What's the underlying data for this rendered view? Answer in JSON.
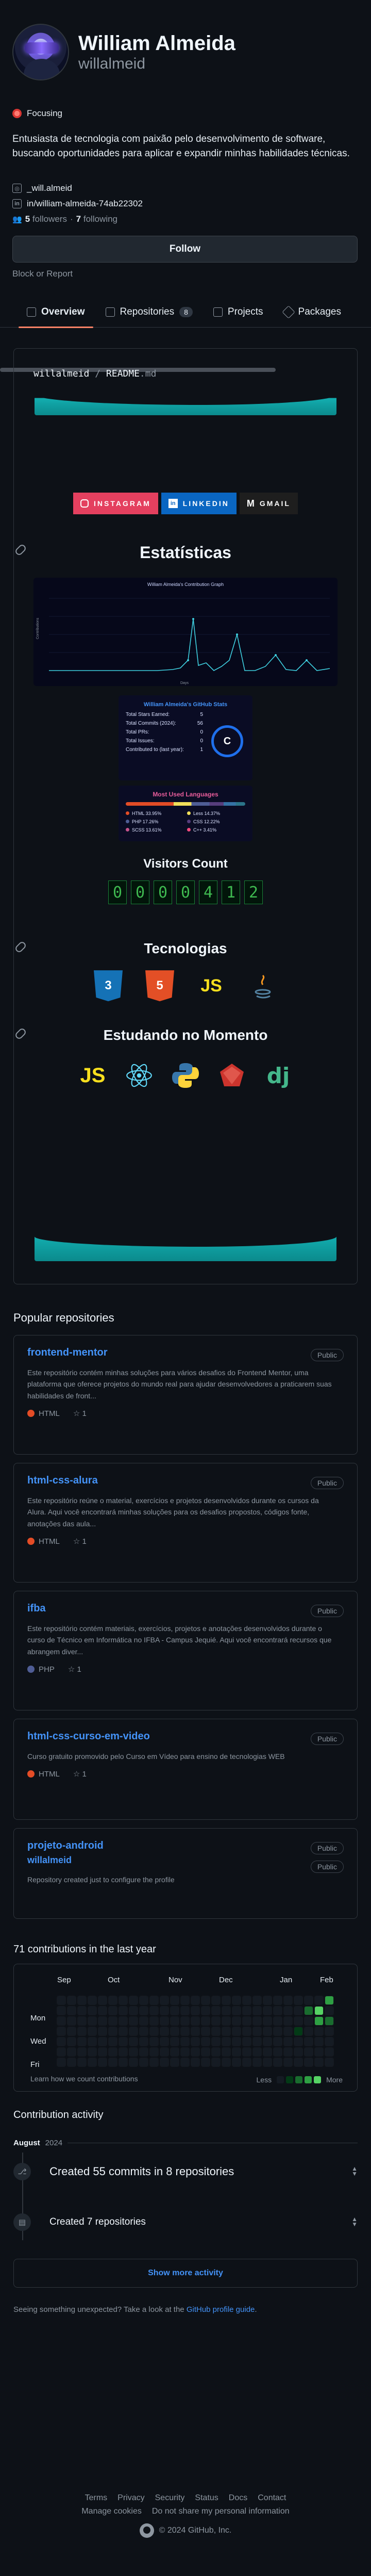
{
  "profile": {
    "name": "William Almeida",
    "login": "willalmeid",
    "status": "Focusing",
    "bio": "Entusiasta de tecnologia com paixão pelo desenvolvimento de software, buscando oportunidades para aplicar e expandir minhas habilidades técnicas.",
    "social1": "_will.almeid",
    "social2": "in/william-almeida-74ab22302",
    "followers": "5",
    "followers_label": "followers",
    "following": "7",
    "following_label": "following",
    "follow_button": "Follow",
    "block": "Block or Report"
  },
  "tabs": [
    {
      "label": "Overview"
    },
    {
      "label": "Repositories",
      "count": "8"
    },
    {
      "label": "Projects"
    },
    {
      "label": "Packages"
    }
  ],
  "readme": {
    "path_user": "willalmeid",
    "path_sep": " / ",
    "path_file": "README",
    "path_ext": ".md",
    "badges": [
      "INSTAGRAM",
      "LINKEDIN",
      "GMAIL"
    ],
    "stats_heading": "Estatísticas",
    "graph_title": "William Almeida's Contribution Graph",
    "graph_ylabel": "Contributions",
    "graph_xlabel": "Days",
    "github_stats": {
      "title": "William Almeida's GitHub Stats",
      "rows": [
        {
          "label": "Total Stars Earned:",
          "value": "5"
        },
        {
          "label": "Total Commits (2024):",
          "value": "56"
        },
        {
          "label": "Total PRs:",
          "value": "0"
        },
        {
          "label": "Total Issues:",
          "value": "0"
        },
        {
          "label": "Contributed to (last year):",
          "value": "1"
        }
      ],
      "grade": "C"
    },
    "langs": {
      "title": "Most Used Languages",
      "items": [
        {
          "label": "HTML 33.95%",
          "color": "#e34c26"
        },
        {
          "label": "Less 14.37%",
          "color": "#f1e05a"
        },
        {
          "label": "PHP 17.26%",
          "color": "#4F5D95"
        },
        {
          "label": "CSS 12.22%",
          "color": "#563d7c"
        },
        {
          "label": "SCSS 13.61%",
          "color": "#c6538c"
        },
        {
          "label": "C++ 3.41%",
          "color": "#f34b7d"
        }
      ]
    },
    "visitors_title": "Visitors Count",
    "visitors_digits": [
      "0",
      "0",
      "0",
      "0",
      "4",
      "1",
      "2"
    ],
    "tech_heading": "Tecnologias",
    "tech": [
      "CSS3",
      "HTML5",
      "JS",
      "Java"
    ],
    "learning_heading": "Estudando no Momento",
    "learning": [
      "JS",
      "React",
      "Python",
      "Ruby",
      "Django"
    ]
  },
  "popular": {
    "title": "Popular repositories",
    "public_label": "Public",
    "repos": [
      {
        "name": "frontend-mentor",
        "desc": "Este repositório contém minhas soluções para vários desafios do Frontend Mentor, uma plataforma que oferece projetos do mundo real para ajudar desenvolvedores a praticarem suas habilidades de front...",
        "lang": "HTML",
        "lang_color": "#e34c26",
        "stars": "1"
      },
      {
        "name": "html-css-alura",
        "desc": "Este repositório reúne o material, exercícios e projetos desenvolvidos durante os cursos da Alura. Aqui você encontrará minhas soluções para os desafios propostos, códigos fonte, anotações das aula...",
        "lang": "HTML",
        "lang_color": "#e34c26",
        "stars": "1"
      },
      {
        "name": "ifba",
        "desc": "Este repositório contém materiais, exercícios, projetos e anotações desenvolvidos durante o curso de Técnico em Informática no IFBA - Campus Jequié. Aqui você encontrará recursos que abrangem diver...",
        "lang": "PHP",
        "lang_color": "#4F5D95",
        "stars": "1"
      },
      {
        "name": "html-css-curso-em-video",
        "desc": "Curso gratuito promovido pelo Curso em Vídeo para ensino de tecnologias WEB",
        "lang": "HTML",
        "lang_color": "#e34c26",
        "stars": "1"
      },
      {
        "name": "projeto-android",
        "owner": "willalmeid",
        "desc": "Repository created just to configure the profile"
      }
    ]
  },
  "contributions": {
    "title": "71 contributions in the last year",
    "months": [
      "Sep",
      "Oct",
      "Nov",
      "Dec",
      "Jan",
      "Feb"
    ],
    "days": [
      "Mon",
      "Wed",
      "Fri"
    ],
    "learn": "Learn how we count contributions",
    "less": "Less",
    "more": "More",
    "colors": [
      "#151b23",
      "#033a16",
      "#196c2e",
      "#2ea043",
      "#56d364"
    ]
  },
  "activity": {
    "title": "Contribution activity",
    "month": "August",
    "year": "2024",
    "items": [
      "Created 55 commits in 8 repositories",
      "Created 7 repositories"
    ],
    "show_more": "Show more activity",
    "unexpected": "Seeing something unexpected? Take a look at the",
    "unexpected_link": "GitHub profile guide",
    "unexpected_end": "."
  },
  "footer": {
    "links1": [
      "Terms",
      "Privacy",
      "Security",
      "Status",
      "Docs",
      "Contact"
    ],
    "links2": [
      "Manage cookies",
      "Do not share my personal information"
    ],
    "copyright": "© 2024 GitHub, Inc."
  }
}
